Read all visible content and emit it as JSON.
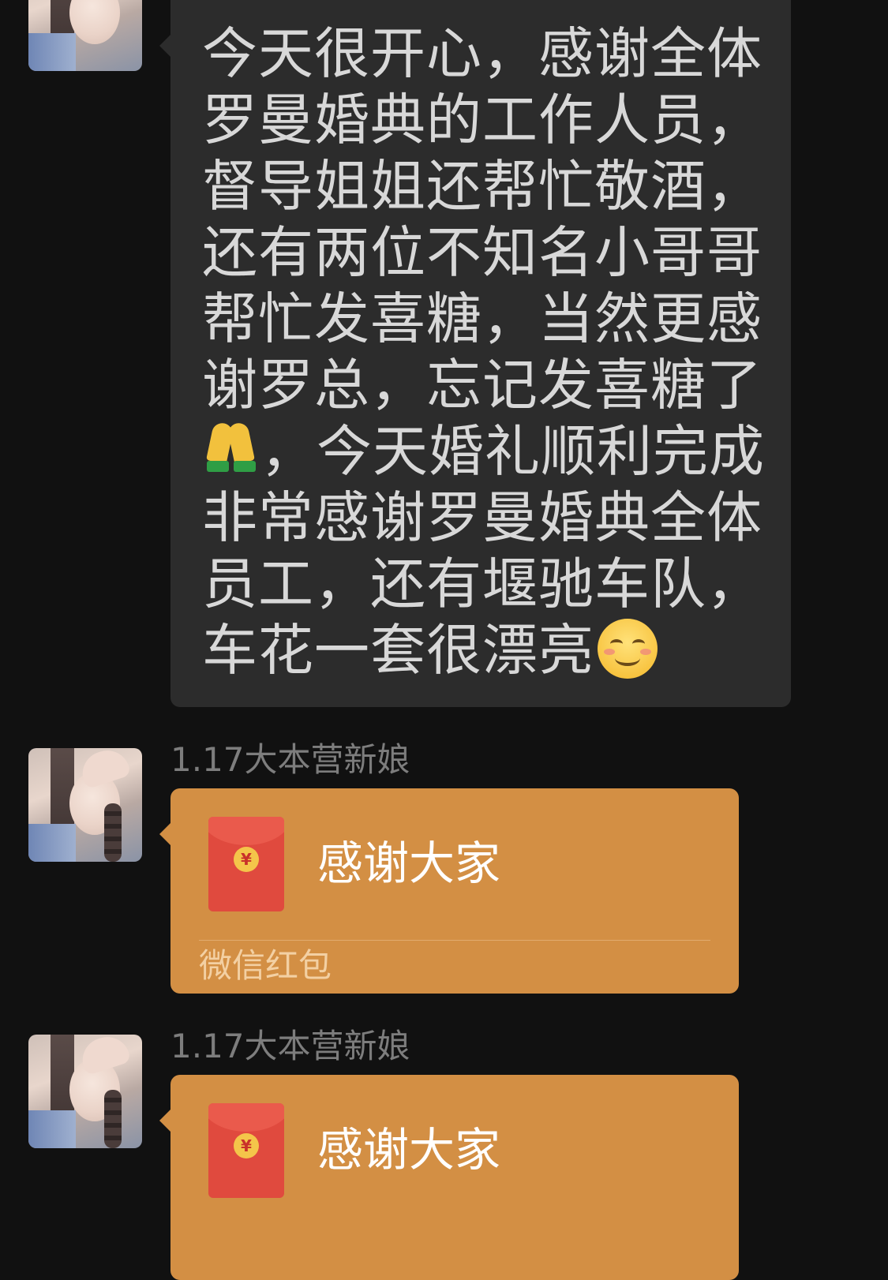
{
  "messages": [
    {
      "type": "text",
      "lines": [
        "今天很开心，感谢全体",
        "罗曼婚典的工作人员，",
        "督导姐姐还帮忙敬酒，",
        "还有两位不知名小哥哥",
        "帮忙发喜糖，当然更感",
        "谢罗总，忘记发喜糖了",
        "，今天婚礼顺利完成",
        "非常感谢罗曼婚典全体",
        "员工，还有堰驰车队，",
        "车花一套很漂亮"
      ],
      "emoji_inline": [
        "folded-hands-emoji",
        "smiling-face-emoji"
      ]
    },
    {
      "type": "red_packet",
      "sender": "1.17大本营新娘",
      "title": "感谢大家",
      "footer": "微信红包",
      "coin_symbol": "¥"
    },
    {
      "type": "red_packet",
      "sender": "1.17大本营新娘",
      "title": "感谢大家",
      "coin_symbol": "¥"
    }
  ],
  "colors": {
    "background": "#111111",
    "text_bubble": "#2c2c2c",
    "red_packet": "#d38f44",
    "envelope": "#e04a3e"
  }
}
